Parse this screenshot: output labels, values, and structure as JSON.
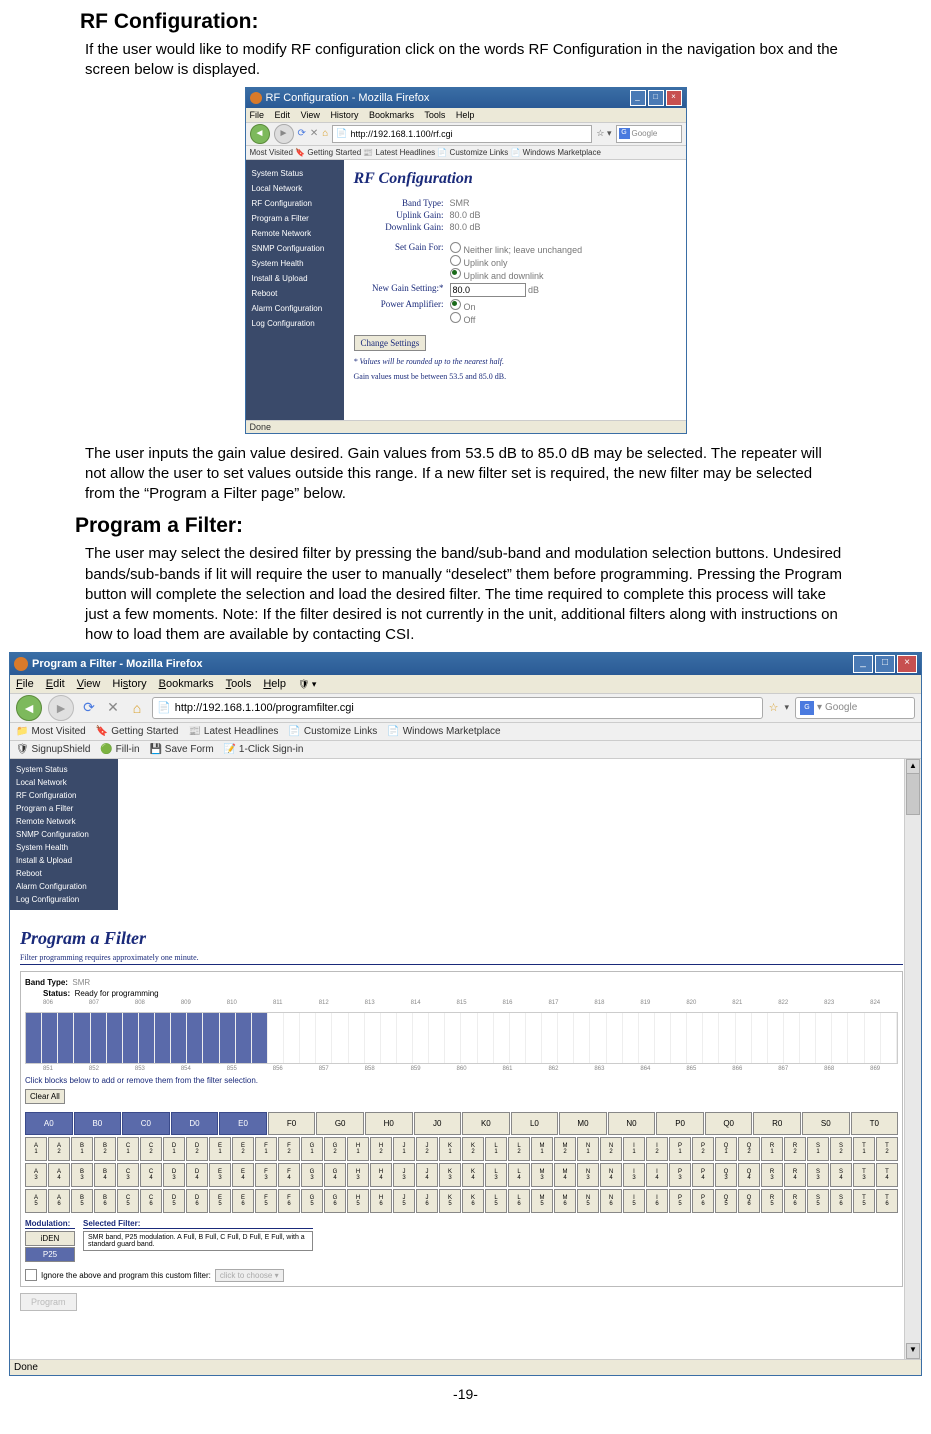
{
  "section_rf_title": "RF Configuration:",
  "rf_intro": "If the user would like to modify RF configuration click on the words RF Configuration in the navigation box and the screen below is displayed.",
  "rf_outro": "The user inputs the gain value desired. Gain values from 53.5 dB to 85.0 dB may be selected. The repeater will not allow the user to set values outside this range. If a new filter set is required, the new filter may be selected from the “Program a Filter page” below.",
  "section_filter_title": "Program a Filter:",
  "filter_intro": "The user may select the desired filter by pressing the band/sub-band and modulation selection buttons. Undesired bands/sub-bands if lit will require the user to manually “deselect” them before programming.   Pressing the Program button will complete the selection and load the desired filter. The time required to complete this process will take just a few moments.  Note: If the filter desired is not currently in the unit, additional filters along with instructions on how to load them are available by contacting CSI.",
  "pagefoot": "-19-",
  "win1": {
    "title": "RF Configuration - Mozilla Firefox",
    "menus": [
      "File",
      "Edit",
      "View",
      "History",
      "Bookmarks",
      "Tools",
      "Help"
    ],
    "url": "http://192.168.1.100/rf.cgi",
    "search_ph": "Google",
    "bookmarks": "Most Visited  🔖 Getting Started  📰 Latest Headlines  📄 Customize Links  📄 Windows Marketplace",
    "sidebar": [
      "System Status",
      "Local Network",
      "RF Configuration",
      "Program a Filter",
      "Remote Network",
      "SNMP Configuration",
      "System Health",
      "Install & Upload",
      "Reboot",
      "Alarm Configuration",
      "Log Configuration"
    ],
    "h3": "RF Configuration",
    "fields": {
      "band_type_l": "Band Type:",
      "band_type_v": "SMR",
      "uplink_l": "Uplink Gain:",
      "uplink_v": "80.0 dB",
      "downlink_l": "Downlink Gain:",
      "downlink_v": "80.0 dB",
      "setgain_l": "Set Gain For:",
      "opt_neither": "Neither link; leave unchanged",
      "opt_uplink": "Uplink only",
      "opt_both": "Uplink and downlink",
      "newgain_l": "New Gain Setting:*",
      "newgain_v": "80.0",
      "newgain_unit": "dB",
      "pa_l": "Power Amplifier:",
      "pa_on": "On",
      "pa_off": "Off",
      "btn": "Change Settings",
      "note1": "* Values will be rounded up to the nearest half.",
      "note2": "Gain values must be between 53.5 and 85.0 dB."
    },
    "status": "Done"
  },
  "win2": {
    "title": "Program a Filter - Mozilla Firefox",
    "menus": [
      [
        "F",
        "ile"
      ],
      [
        "E",
        "dit"
      ],
      [
        "V",
        "iew"
      ],
      [
        "Hi",
        "s",
        "tory"
      ],
      [
        "B",
        "ookmarks"
      ],
      [
        "T",
        "ools"
      ],
      [
        "H",
        "elp"
      ]
    ],
    "url": "http://192.168.1.100/programfilter.cgi",
    "search_ph": "Google",
    "bookbar": [
      "Most Visited",
      "Getting Started",
      "Latest Headlines",
      "Customize Links",
      "Windows Marketplace"
    ],
    "bookbar2": [
      "SignupShield",
      "Fill-in",
      "Save Form",
      "1-Click Sign-in"
    ],
    "sidebar": [
      "System Status",
      "Local Network",
      "RF Configuration",
      "Program a Filter",
      "Remote Network",
      "SNMP Configuration",
      "System Health",
      "Install & Upload",
      "Reboot",
      "Alarm Configuration",
      "Log Configuration"
    ],
    "pgtitle": "Program a Filter",
    "subnote": "Filter programming requires approximately one minute.",
    "band_type_l": "Band Type:",
    "band_type_v": "SMR",
    "status_l": "Status:",
    "status_v": "Ready for programming",
    "axis_top": [
      "806",
      "807",
      "808",
      "809",
      "810",
      "811",
      "812",
      "813",
      "814",
      "815",
      "816",
      "817",
      "818",
      "819",
      "820",
      "821",
      "822",
      "823",
      "824"
    ],
    "axis_bot": [
      "851",
      "852",
      "853",
      "854",
      "855",
      "856",
      "857",
      "858",
      "859",
      "860",
      "861",
      "862",
      "863",
      "864",
      "865",
      "866",
      "867",
      "868",
      "869"
    ],
    "hint": "Click blocks below to add or remove them from the filter selection.",
    "clear": "Clear All",
    "row0": [
      {
        "l": "A0",
        "s": true
      },
      {
        "l": "B0",
        "s": true
      },
      {
        "l": "C0",
        "s": true
      },
      {
        "l": "D0",
        "s": true
      },
      {
        "l": "E0",
        "s": true
      },
      {
        "l": "F0"
      },
      {
        "l": "G0"
      },
      {
        "l": "H0"
      },
      {
        "l": "J0"
      },
      {
        "l": "K0"
      },
      {
        "l": "L0"
      },
      {
        "l": "M0"
      },
      {
        "l": "N0"
      },
      {
        "l": "P0"
      },
      {
        "l": "Q0"
      },
      {
        "l": "R0"
      },
      {
        "l": "S0"
      },
      {
        "l": "T0"
      }
    ],
    "rows_small": [
      [
        "A1",
        "A2",
        "B1",
        "B2",
        "C1",
        "C2",
        "D1",
        "D2",
        "E1",
        "E2",
        "F1",
        "F2",
        "G1",
        "G2",
        "H1",
        "H2",
        "J1",
        "J2",
        "K1",
        "K2",
        "L1",
        "L2",
        "M1",
        "M2",
        "N1",
        "N2",
        "I1",
        "I2",
        "P1",
        "P2",
        "Q1",
        "Q2",
        "R1",
        "R2",
        "S1",
        "S2",
        "T1",
        "T2"
      ],
      [
        "A3",
        "A4",
        "B3",
        "B4",
        "C3",
        "C4",
        "D3",
        "D4",
        "E3",
        "E4",
        "F3",
        "F4",
        "G3",
        "G4",
        "H3",
        "H4",
        "J3",
        "J4",
        "K3",
        "K4",
        "L3",
        "L4",
        "M3",
        "M4",
        "N3",
        "N4",
        "I3",
        "I4",
        "P3",
        "P4",
        "Q3",
        "Q4",
        "R3",
        "R4",
        "S3",
        "S4",
        "T3",
        "T4"
      ],
      [
        "A5",
        "A6",
        "B5",
        "B6",
        "C5",
        "C6",
        "D5",
        "D6",
        "E5",
        "E6",
        "F5",
        "F6",
        "G5",
        "G6",
        "H5",
        "H6",
        "J5",
        "J6",
        "K5",
        "K6",
        "L5",
        "L6",
        "M5",
        "M6",
        "N5",
        "N6",
        "I5",
        "I6",
        "P5",
        "P6",
        "Q5",
        "Q6",
        "R5",
        "R6",
        "S5",
        "S6",
        "T5",
        "T6"
      ]
    ],
    "mod_l": "Modulation:",
    "mod_opts": [
      {
        "l": "iDEN"
      },
      {
        "l": "P25",
        "s": true
      }
    ],
    "selfilt_l": "Selected Filter:",
    "selfilt_v": "SMR band, P25 modulation. A Full, B Full, C Full, D Full, E Full, with a standard guard band.",
    "ignore": "Ignore the above and program this custom filter:",
    "ignore_dd": "click to choose",
    "progbtn": "Program",
    "status2": "Done"
  }
}
